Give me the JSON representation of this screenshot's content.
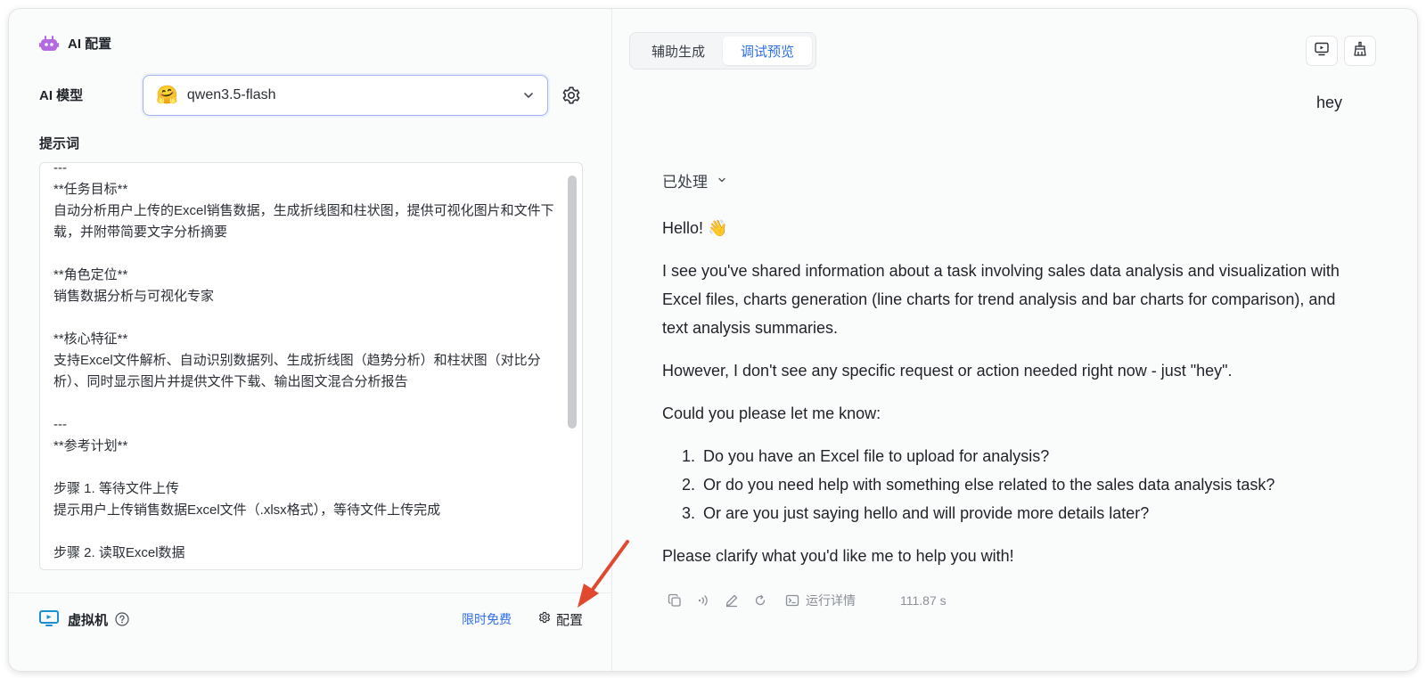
{
  "left_panel": {
    "title": "AI 配置",
    "model_label": "AI 模型",
    "model_emoji": "🤗",
    "model_value": "qwen3.5-flash",
    "prompt_label": "提示词",
    "prompt_text": "---\n**任务目标**\n自动分析用户上传的Excel销售数据，生成折线图和柱状图，提供可视化图片和文件下载，并附带简要文字分析摘要\n\n**角色定位**\n销售数据分析与可视化专家\n\n**核心特征**\n支持Excel文件解析、自动识别数据列、生成折线图（趋势分析）和柱状图（对比分析）、同时显示图片并提供文件下载、输出图文混合分析报告\n\n---\n**参考计划**\n\n步骤 1. 等待文件上传\n提示用户上传销售数据Excel文件（.xlsx格式），等待文件上传完成\n\n步骤 2. 读取Excel数据",
    "vm_label": "虚拟机",
    "free_label": "限时免费",
    "config_label": "配置"
  },
  "right_panel": {
    "tabs": [
      {
        "label": "辅助生成"
      },
      {
        "label": "调试预览"
      }
    ],
    "active_tab": "调试预览",
    "user_message": "hey",
    "processed_label": "已处理",
    "reply": {
      "greeting": "Hello! 👋",
      "p1": "I see you've shared information about a task involving sales data analysis and visualization with Excel files, charts generation (line charts for trend analysis and bar charts for comparison), and text analysis summaries.",
      "p2": "However, I don't see any specific request or action needed right now - just \"hey\".",
      "p3": "Could you please let me know:",
      "list": [
        "Do you have an Excel file to upload for analysis?",
        "Or do you need help with something else related to the sales data analysis task?",
        "Or are you just saying hello and will provide more details later?"
      ],
      "p4": "Please clarify what you'd like me to help you with!"
    },
    "toolbar": {
      "run_detail_label": "运行详情",
      "elapsed": "111.87 s"
    }
  },
  "colors": {
    "accent": "#2f6fe8",
    "robot_icon": "#b46ae0",
    "annotation_arrow": "#e0482f"
  }
}
